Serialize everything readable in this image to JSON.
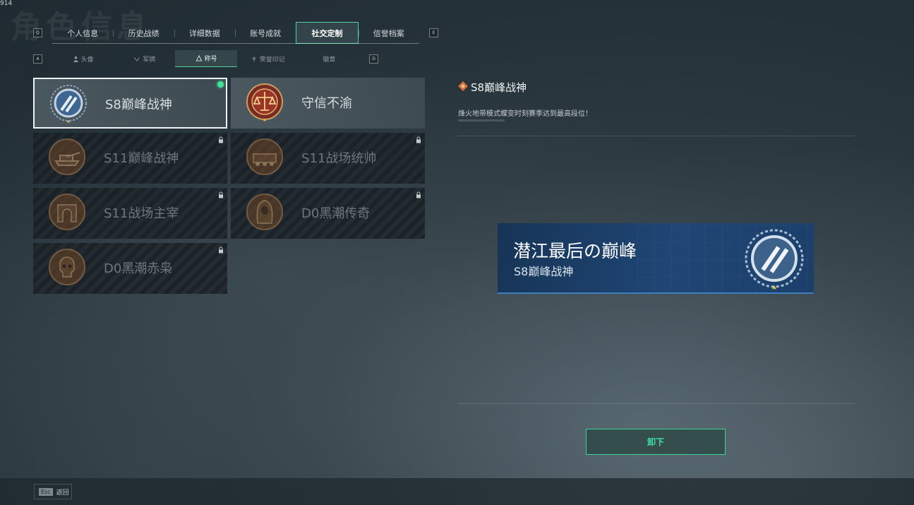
{
  "corner_text": "914",
  "page_bg_title": "角色信息",
  "tabs": {
    "left_key": "Q",
    "right_key": "E",
    "items": [
      {
        "label": "个人信息"
      },
      {
        "label": "历史战绩"
      },
      {
        "label": "详细数据"
      },
      {
        "label": "账号成就"
      },
      {
        "label": "社交定制",
        "active": true
      },
      {
        "label": "信誉档案"
      }
    ]
  },
  "subtabs": {
    "left_key": "A",
    "right_key": "D",
    "items": [
      {
        "label": "头像",
        "icon": "person-icon"
      },
      {
        "label": "军牌",
        "icon": "dogtag-icon"
      },
      {
        "label": "称号",
        "icon": "title-icon",
        "active": true
      },
      {
        "label": "荣誉印记",
        "icon": "honor-icon"
      },
      {
        "label": "徽章",
        "icon": "badge-icon"
      }
    ]
  },
  "titles": [
    {
      "name": "S8巅峰战神",
      "badge": "laurel-emblem",
      "state": "selected",
      "equipped": true
    },
    {
      "name": "守信不渝",
      "badge": "scales-emblem",
      "state": "unlocked"
    },
    {
      "name": "S11巅峰战神",
      "badge": "tank-emblem",
      "state": "locked"
    },
    {
      "name": "S11战场统帅",
      "badge": "apc-emblem",
      "state": "locked"
    },
    {
      "name": "S11战场主宰",
      "badge": "arch-emblem",
      "state": "locked"
    },
    {
      "name": "D0黑潮传奇",
      "badge": "hooded-figure-emblem",
      "state": "locked"
    },
    {
      "name": "D0黑潮赤枭",
      "badge": "skull-emblem",
      "state": "locked"
    }
  ],
  "detail": {
    "title": "S8巅峰战神",
    "description": "烽火地带模式蝶变时刻赛季达到最高段位！",
    "banner_title": "潜江最后の巅峰",
    "banner_subtitle": "S8巅峰战神"
  },
  "unequip_label": "卸下",
  "footer": {
    "key": "Esc",
    "label": "返回"
  },
  "colors": {
    "accent": "#3fe0a5",
    "banner": "#1f4675",
    "bronze": "#8a5a32"
  }
}
